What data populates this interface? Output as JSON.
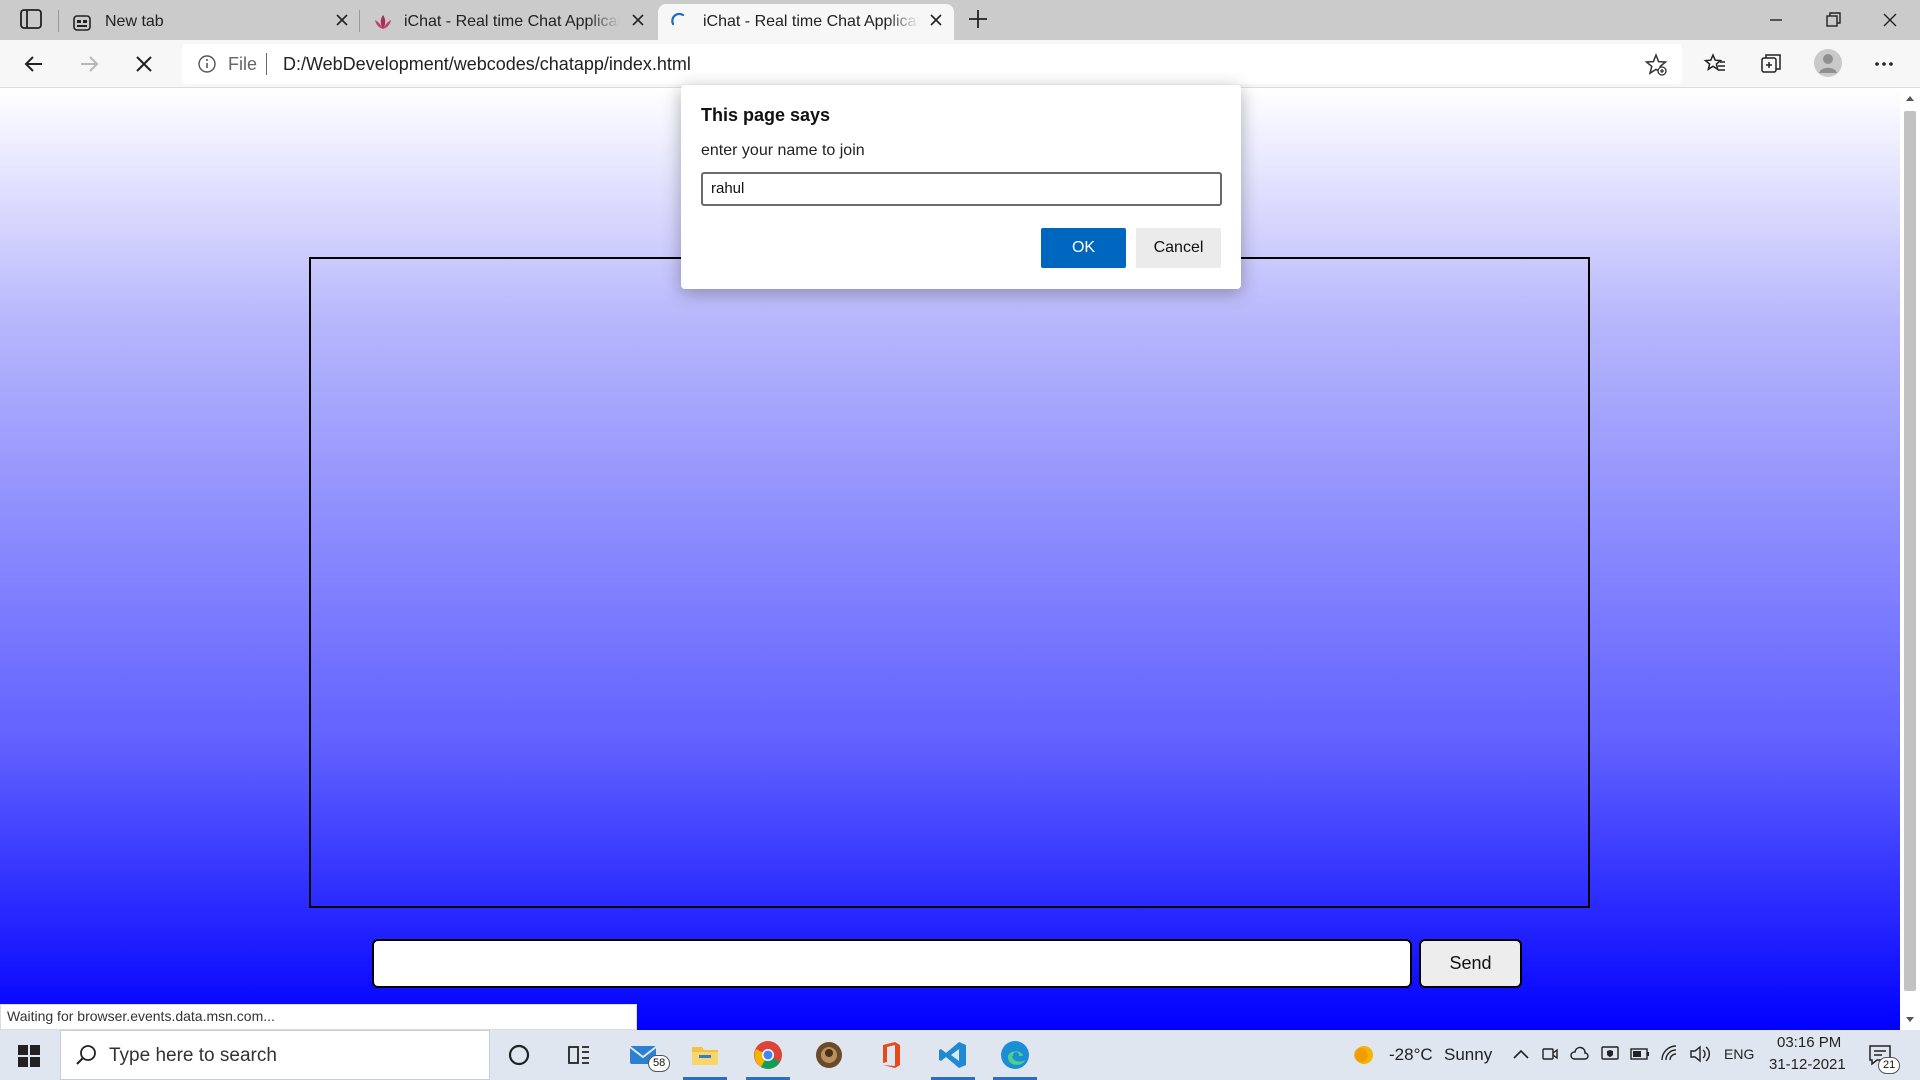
{
  "browser": {
    "tabs": [
      {
        "title": "New tab",
        "active": false
      },
      {
        "title": "iChat - Real time Chat Application",
        "active": false
      },
      {
        "title": "iChat - Real time Chat Application",
        "active": true
      }
    ],
    "address": {
      "scheme_label": "File",
      "url": "D:/WebDevelopment/webcodes/chatapp/index.html"
    },
    "status_text": "Waiting for browser.events.data.msn.com..."
  },
  "dialog": {
    "title": "This page says",
    "message": "enter your name to join",
    "input_value": "rahul",
    "ok_label": "OK",
    "cancel_label": "Cancel"
  },
  "page": {
    "message_input_value": "",
    "send_label": "Send"
  },
  "taskbar": {
    "search_placeholder": "Type here to search",
    "mail_badge": "58",
    "weather_temp": "-28°C",
    "weather_text": "Sunny",
    "language": "ENG",
    "time": "03:16 PM",
    "date": "31-12-2021",
    "notification_count": "21"
  },
  "colors": {
    "accent": "#0067c0",
    "page_gradient_top": "#ffffff",
    "page_gradient_bottom": "#0000ff"
  }
}
